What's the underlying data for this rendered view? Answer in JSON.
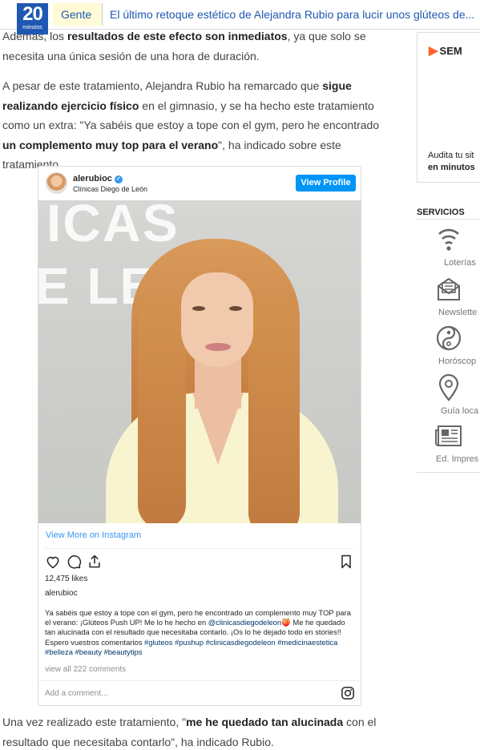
{
  "header": {
    "logo_number": "20",
    "logo_sub": "minutos",
    "section": "Gente",
    "headline": "El último retoque estético de Alejandra Rubio para lucir unos glúteos de..."
  },
  "article": {
    "p1": {
      "a": "Además, los ",
      "b": "resultados de este efecto son inmediatos",
      "c": ", ya que solo se necesita una única sesión de una hora de duración."
    },
    "p2": {
      "a": "A pesar de este tratamiento, Alejandra Rubio ha remarcado que ",
      "b": "sigue realizando ejercicio físico",
      "c": " en el gimnasio, y se ha hecho este tratamiento como un extra: \"Ya sabéis que estoy a tope con el gym, pero he encontrado ",
      "d": "un complemento muy top para el verano",
      "e": "\", ha indicado sobre este tratamiento."
    },
    "p3": {
      "a": "Una vez realizado este tratamiento, \"",
      "b": "me he quedado tan alucinada",
      "c": " con el resultado que necesitaba contarlo\", ha indicado Rubio."
    }
  },
  "instagram": {
    "username": "alerubioc",
    "verified_mark": "✓",
    "location": "Clínicas Diego de León",
    "view_profile": "View Profile",
    "photo_text_1": "ICAS",
    "photo_text_2": "E LEÓ",
    "view_more": "View More on Instagram",
    "likes": "12,475 likes",
    "owner": "alerubioc",
    "caption_1": "Ya sabéis que estoy a tope con el gym, pero he encontrado un complemento muy TOP para el verano: ¡Glúteos Push UP! Me lo he hecho en ",
    "caption_tag_1": "@clinicasdiegodeleon",
    "caption_emoji": "🍑",
    "caption_2": " Me he quedado tan alucinada con el resultado que necesitaba contarlo. ¡Os lo he dejado todo en stories!! Espero vuestros comentarios ",
    "caption_tag_2": "#gluteos #pushup #clinicasdiegodeleon #medicinaestetica #belleza #beauty #beautytips",
    "comments": "view all 222 comments",
    "add_comment": "Add a comment..."
  },
  "sidebar": {
    "ad_brand": "SEM",
    "ad_text_1": "Audita tu sit",
    "ad_text_2": "en minutos",
    "services_title": "SERVICIOS",
    "services": [
      {
        "label": "Loterías",
        "icon": "lottery-icon"
      },
      {
        "label": "Newslette",
        "icon": "newsletter-icon"
      },
      {
        "label": "Horóscop",
        "icon": "horoscope-icon"
      },
      {
        "label": "Guía loca",
        "icon": "location-icon"
      },
      {
        "label": "Ed. Impres",
        "icon": "newspaper-icon"
      }
    ]
  },
  "colors": {
    "brand_blue": "#1f58b2",
    "section_bg": "#fffbd6",
    "instagram_blue": "#0095f6",
    "semrush_orange": "#ff642d"
  }
}
